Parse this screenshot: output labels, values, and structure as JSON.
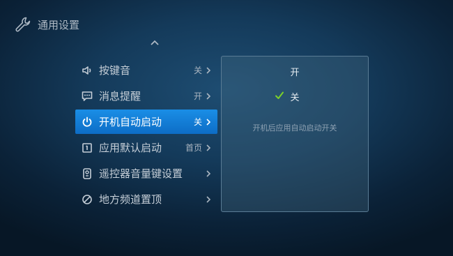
{
  "header": {
    "title": "通用设置",
    "icon": "wrench-icon"
  },
  "menu": {
    "items": [
      {
        "label": "按键音",
        "value": "关",
        "icon": "speaker-icon"
      },
      {
        "label": "消息提醒",
        "value": "开",
        "icon": "message-icon"
      },
      {
        "label": "开机自动启动",
        "value": "关",
        "icon": "power-icon"
      },
      {
        "label": "应用默认启动",
        "value": "首页",
        "icon": "app-launch-icon"
      },
      {
        "label": "遥控器音量键设置",
        "value": "",
        "icon": "remote-icon"
      },
      {
        "label": "地方频道置顶",
        "value": "",
        "icon": "no-sign-icon"
      }
    ],
    "selected_index": 2
  },
  "panel": {
    "options": [
      "开",
      "关"
    ],
    "checked_option": "关",
    "description": "开机后应用自动启动开关"
  },
  "colors": {
    "accent": "#1a8ee6",
    "check": "#7cd12a"
  }
}
